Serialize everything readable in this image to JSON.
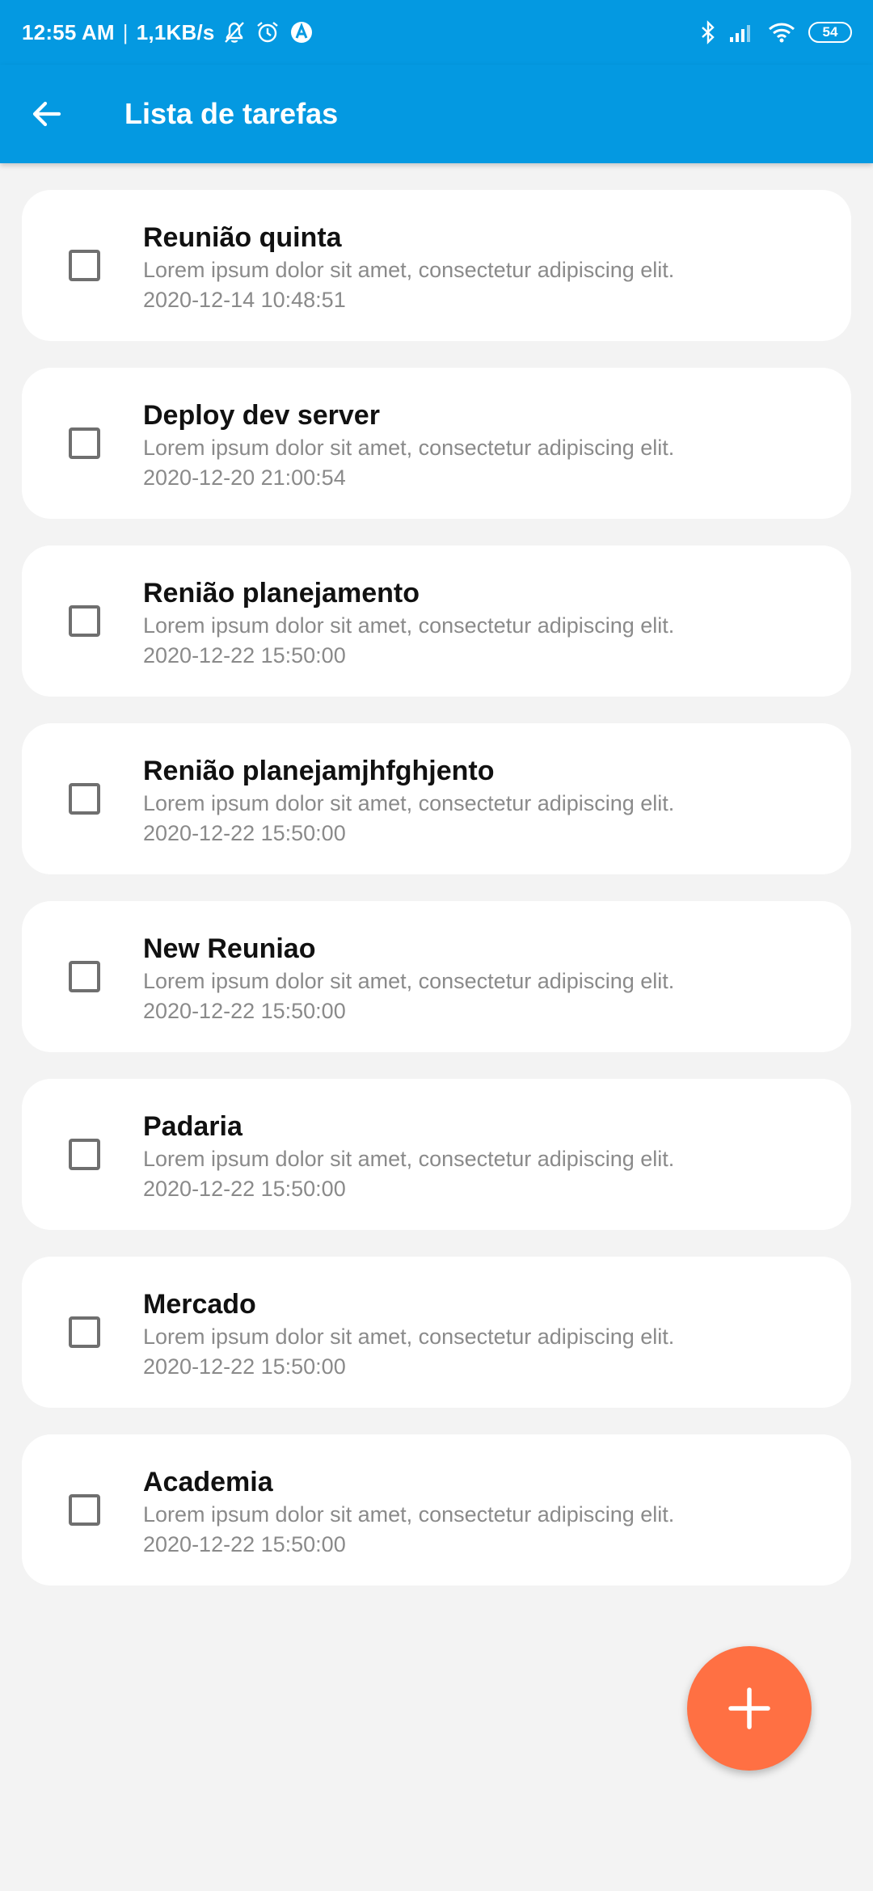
{
  "status_bar": {
    "time": "12:55 AM",
    "speed": "1,1KB/s",
    "battery": "54",
    "icons": [
      "bell-off-icon",
      "alarm-icon",
      "app-notification-icon",
      "bluetooth-icon",
      "signal-icon",
      "wifi-icon",
      "battery-icon"
    ]
  },
  "app_bar": {
    "title": "Lista de tarefas",
    "back_icon": "arrow-back-icon"
  },
  "tasks": [
    {
      "title": "Reunião quinta",
      "description": "Lorem ipsum dolor sit amet, consectetur adipiscing elit.",
      "date": "2020-12-14 10:48:51",
      "checked": false
    },
    {
      "title": "Deploy dev server",
      "description": "Lorem ipsum dolor sit amet, consectetur adipiscing elit.",
      "date": "2020-12-20 21:00:54",
      "checked": false
    },
    {
      "title": "Renião planejamento",
      "description": "Lorem ipsum dolor sit amet, consectetur adipiscing elit.",
      "date": "2020-12-22 15:50:00",
      "checked": false
    },
    {
      "title": "Renião planejamjhfghjento",
      "description": "Lorem ipsum dolor sit amet, consectetur adipiscing elit.",
      "date": "2020-12-22 15:50:00",
      "checked": false
    },
    {
      "title": "New Reuniao",
      "description": "Lorem ipsum dolor sit amet, consectetur adipiscing elit.",
      "date": "2020-12-22 15:50:00",
      "checked": false
    },
    {
      "title": "Padaria",
      "description": "Lorem ipsum dolor sit amet, consectetur adipiscing elit.",
      "date": "2020-12-22 15:50:00",
      "checked": false
    },
    {
      "title": "Mercado",
      "description": "Lorem ipsum dolor sit amet, consectetur adipiscing elit.",
      "date": "2020-12-22 15:50:00",
      "checked": false
    },
    {
      "title": "Academia",
      "description": "Lorem ipsum dolor sit amet, consectetur adipiscing elit.",
      "date": "2020-12-22 15:50:00",
      "checked": false
    }
  ],
  "fab": {
    "icon": "plus-icon"
  },
  "colors": {
    "primary": "#0499e1",
    "accent": "#ff7043",
    "background": "#f3f3f3",
    "card": "#ffffff",
    "secondary_text": "#8a8a8a"
  }
}
